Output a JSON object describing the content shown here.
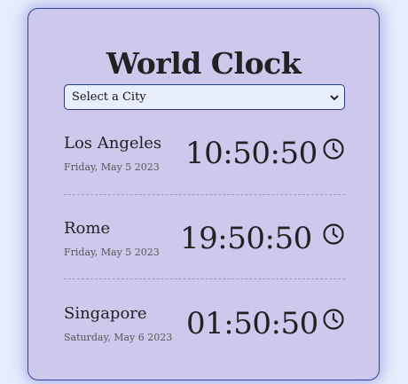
{
  "header": {
    "title": "World Clock"
  },
  "city_select": {
    "selected": "Select a City"
  },
  "clocks": [
    {
      "city": "Los Angeles",
      "date": "Friday, May 5 2023",
      "time": "10:50:50",
      "icon": "clock-icon"
    },
    {
      "city": "Rome",
      "date": "Friday, May 5 2023",
      "time": "19:50:50",
      "icon": "clock-icon"
    },
    {
      "city": "Singapore",
      "date": "Saturday, May 6 2023",
      "time": "01:50:50",
      "icon": "clock-icon"
    }
  ],
  "colors": {
    "page_background": "#e6ecfb",
    "card_background": "#cdc9ec",
    "card_border": "#3a3f9c",
    "text": "#222222"
  }
}
